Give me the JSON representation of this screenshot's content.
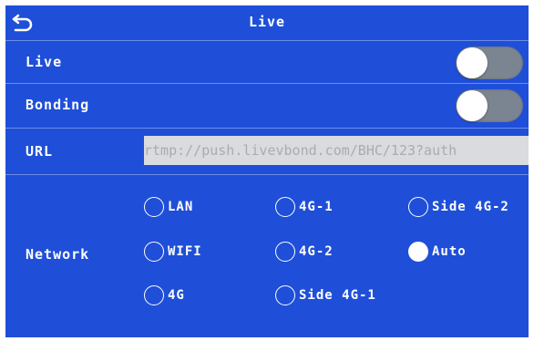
{
  "header": {
    "title": "Live",
    "back_icon": "back-arrow-icon"
  },
  "live_row": {
    "label": "Live",
    "enabled": false
  },
  "bonding_row": {
    "label": "Bonding",
    "enabled": false
  },
  "url_row": {
    "label": "URL",
    "value": "rtmp://push.livevbond.com/BHC/123?auth"
  },
  "network": {
    "label": "Network",
    "selected": "Auto",
    "options": [
      {
        "label": "LAN"
      },
      {
        "label": "4G-1"
      },
      {
        "label": "Side 4G-2"
      },
      {
        "label": "WIFI"
      },
      {
        "label": "4G-2"
      },
      {
        "label": "Auto"
      },
      {
        "label": "4G"
      },
      {
        "label": "Side 4G-1"
      }
    ]
  },
  "colors": {
    "background": "#1f4fd8",
    "toggle_off": "#7b8591",
    "url_field": "#d9dbde"
  }
}
